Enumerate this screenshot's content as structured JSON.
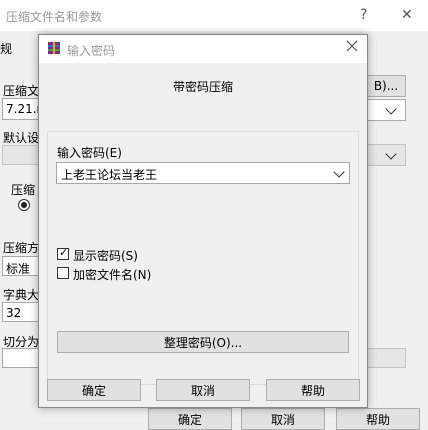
{
  "background": {
    "title": "压缩文件名和参数",
    "help_icon": "?",
    "close_icon": "✕",
    "tab_label": "规",
    "archive_label": "压缩文",
    "archive_value": "7.21.ra",
    "browse_button": "B)...",
    "profile_label": "默认设",
    "format_label": "压缩",
    "method_label": "压缩方",
    "method_value": "标准",
    "dict_label": "字典大",
    "dict_value": "32",
    "split_label": "切分为",
    "ok_label": "确定",
    "cancel_label": "取消",
    "help_label": "帮助"
  },
  "dialog": {
    "title": "输入密码",
    "heading": "带密码压缩",
    "password_label": "输入密码(E)",
    "password_value": "上老王论坛当老王",
    "show_password_label": "显示密码(S)",
    "show_password_checked": true,
    "encrypt_names_label": "加密文件名(N)",
    "encrypt_names_checked": false,
    "organize_button": "整理密码(O)...",
    "ok_button": "确定",
    "cancel_button": "取消",
    "help_button": "帮助"
  }
}
